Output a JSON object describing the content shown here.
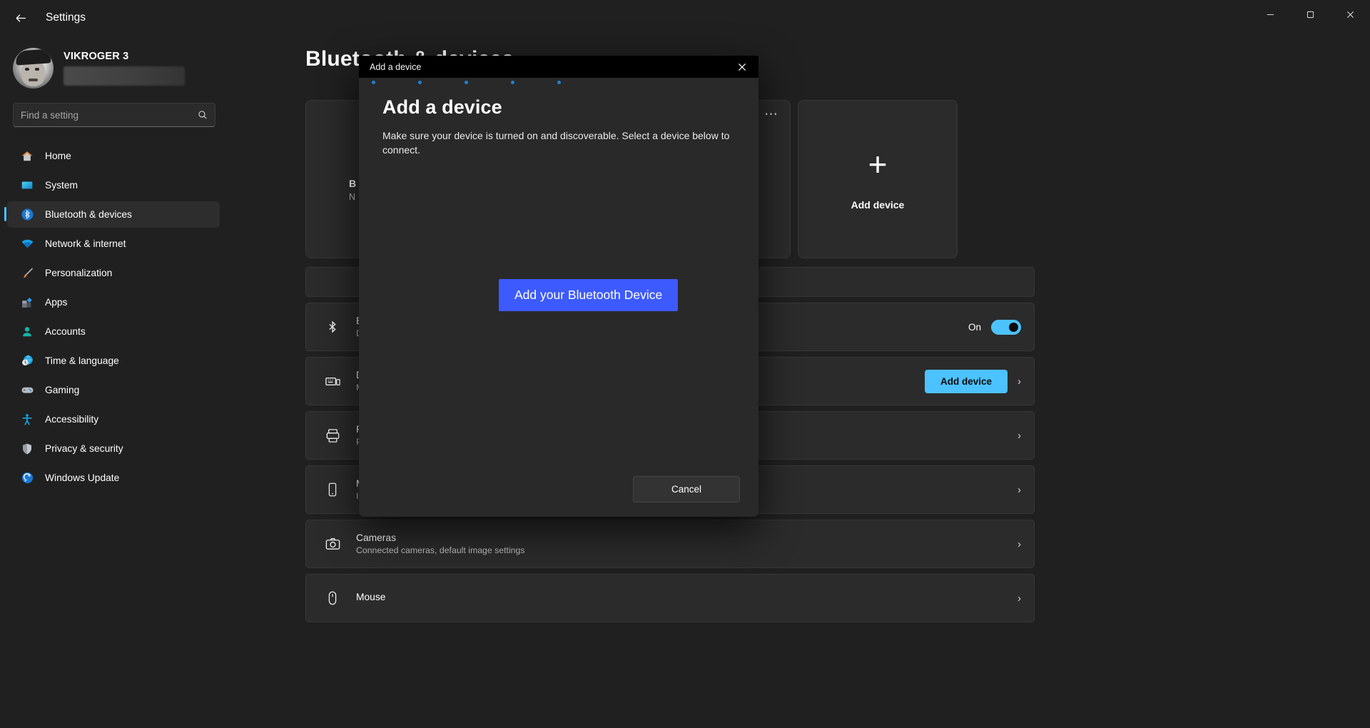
{
  "window": {
    "app_title": "Settings",
    "back_icon": "back-arrow-icon",
    "minimize": "–",
    "maximize": "❐",
    "close": "✕"
  },
  "sidebar": {
    "account": {
      "name": "VIKROGER 3",
      "email_redacted": ""
    },
    "search": {
      "placeholder": "Find a setting",
      "value": "",
      "icon": "search-icon"
    },
    "items": [
      {
        "label": "Home",
        "icon": "home-icon",
        "active": false
      },
      {
        "label": "System",
        "icon": "system-icon",
        "active": false
      },
      {
        "label": "Bluetooth & devices",
        "icon": "bluetooth-icon",
        "active": true
      },
      {
        "label": "Network & internet",
        "icon": "wifi-icon",
        "active": false
      },
      {
        "label": "Personalization",
        "icon": "brush-icon",
        "active": false
      },
      {
        "label": "Apps",
        "icon": "apps-icon",
        "active": false
      },
      {
        "label": "Accounts",
        "icon": "account-icon",
        "active": false
      },
      {
        "label": "Time & language",
        "icon": "clock-globe-icon",
        "active": false
      },
      {
        "label": "Gaming",
        "icon": "gamepad-icon",
        "active": false
      },
      {
        "label": "Accessibility",
        "icon": "accessibility-icon",
        "active": false
      },
      {
        "label": "Privacy & security",
        "icon": "shield-icon",
        "active": false
      },
      {
        "label": "Windows Update",
        "icon": "update-icon",
        "active": false
      }
    ]
  },
  "main": {
    "page_title": "Bluetooth & devices",
    "device_card": {
      "more_icon": "ellipsis-icon",
      "name": "B",
      "sub": "N"
    },
    "add_device_card": {
      "label": "Add device",
      "icon": "plus-icon"
    },
    "rows": [
      {
        "title": "Blu",
        "sub": "Dis",
        "icon": "bluetooth-icon",
        "control": "toggle",
        "toggle_label": "On",
        "toggle_on": true
      },
      {
        "title": "De",
        "sub": "Mo",
        "icon": "devices-icon",
        "control": "button",
        "button_label": "Add device",
        "chevron": "›"
      },
      {
        "title": "Pri",
        "sub": "Pre",
        "icon": "printer-icon",
        "control": "chevron",
        "chevron": "›"
      },
      {
        "title": "Mo",
        "sub": "Ins",
        "icon": "phone-icon",
        "control": "chevron",
        "chevron": "›"
      },
      {
        "title": "Cameras",
        "sub": "Connected cameras, default image settings",
        "icon": "camera-icon",
        "control": "chevron",
        "chevron": "›"
      },
      {
        "title": "Mouse",
        "sub": "",
        "icon": "mouse-icon",
        "control": "chevron",
        "chevron": "›"
      }
    ]
  },
  "dialog": {
    "titlebar_title": "Add a device",
    "close_icon": "close-icon",
    "heading": "Add a device",
    "description": "Make sure your device is turned on and discoverable. Select a device below to connect.",
    "primary_button": "Add your Bluetooth Device",
    "cancel_button": "Cancel",
    "progress_dots": 5
  },
  "colors": {
    "accent": "#4cc2ff",
    "dialog_button": "#3d5afe",
    "dot": "#1f7fd6",
    "window_bg": "#202020",
    "card_bg": "#2b2b2b"
  }
}
